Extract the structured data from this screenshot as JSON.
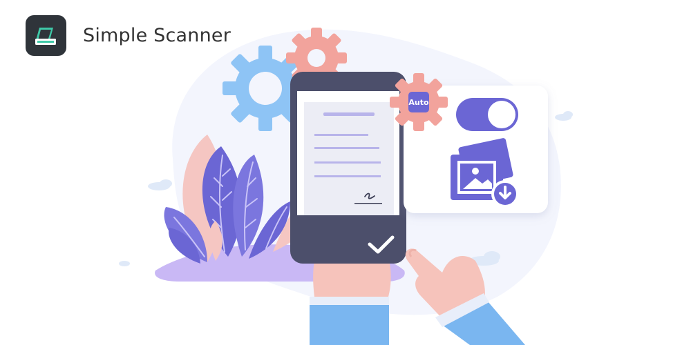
{
  "header": {
    "app_name": "Simple Scanner",
    "logo_icon": "scanner-icon"
  },
  "illustration": {
    "gear_badge_label": "Auto",
    "toggle_state": "on",
    "icons": [
      "gear-icon",
      "toggle-icon",
      "image-download-icon",
      "checkmark-icon",
      "signature-icon"
    ]
  },
  "colors": {
    "accent_purple": "#6b66d4",
    "logo_green": "#3fc9a8",
    "gear_pink": "#f2a39c",
    "gear_blue": "#8ec4f5",
    "phone_dark": "#4c4f6b",
    "sleeve_blue": "#7ab6f0"
  }
}
